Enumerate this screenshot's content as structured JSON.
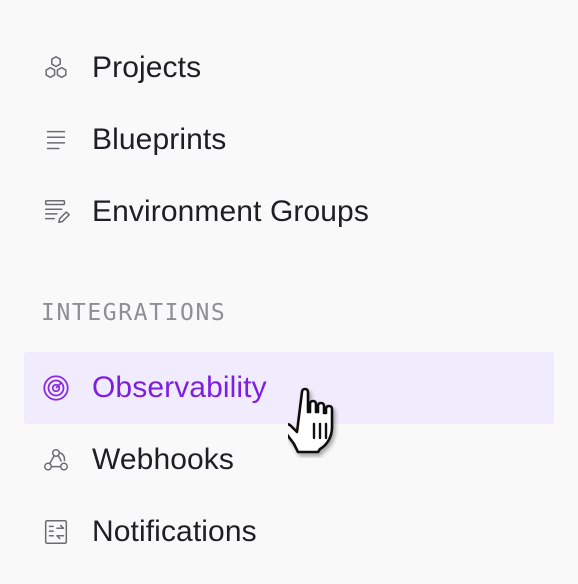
{
  "sidebar": {
    "items": [
      {
        "label": "Projects",
        "icon": "hexagons-icon"
      },
      {
        "label": "Blueprints",
        "icon": "lines-icon"
      },
      {
        "label": "Environment Groups",
        "icon": "env-groups-icon"
      }
    ],
    "integrations": {
      "heading": "INTEGRATIONS",
      "items": [
        {
          "label": "Observability",
          "icon": "target-icon",
          "active": true
        },
        {
          "label": "Webhooks",
          "icon": "webhook-icon"
        },
        {
          "label": "Notifications",
          "icon": "notifications-icon"
        }
      ]
    }
  },
  "colors": {
    "accent": "#7d1fe0",
    "active_bg": "#f1ecfd",
    "text": "#1f1f23",
    "muted": "#8e8e94",
    "background": "#f9f9fa"
  }
}
